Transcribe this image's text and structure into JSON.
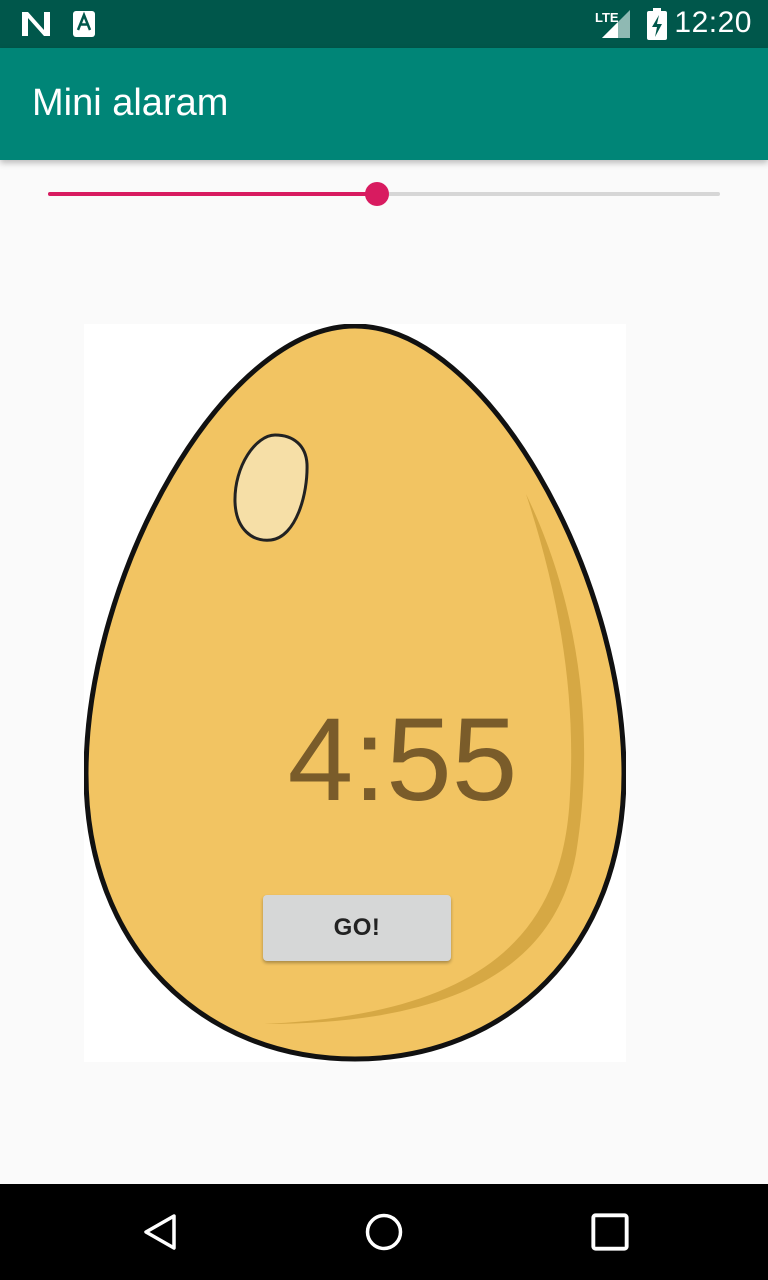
{
  "status_bar": {
    "time": "12:20",
    "network": "LTE",
    "icons": [
      "notification-n-icon",
      "notification-a-icon",
      "signal-icon",
      "battery-charging-icon"
    ]
  },
  "app_bar": {
    "title": "Mini alaram"
  },
  "seekbar": {
    "progress_fraction": 0.49,
    "accent": "#d81b60"
  },
  "timer": {
    "display": "4:55"
  },
  "go_button": {
    "label": "GO!"
  },
  "nav_bar": {
    "icons": [
      "back-icon",
      "home-icon",
      "recents-icon"
    ]
  },
  "colors": {
    "status_bar": "#00574b",
    "app_bar": "#008577",
    "egg": "#f2c462"
  }
}
